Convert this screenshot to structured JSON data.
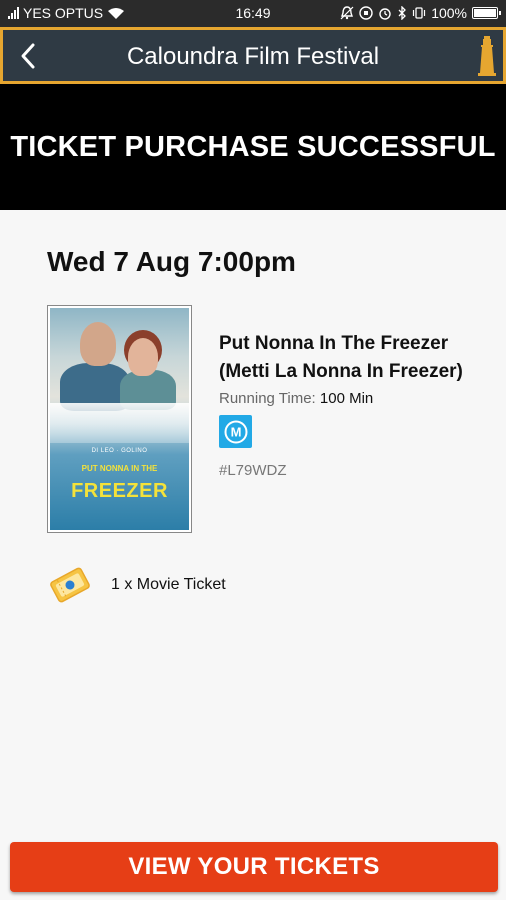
{
  "status_bar": {
    "carrier": "YES OPTUS",
    "time": "16:49",
    "battery_percent": "100%",
    "battery_level": 1.0
  },
  "header": {
    "title": "Caloundra Film Festival",
    "back_icon": "chevron-left-icon",
    "brand_icon": "lighthouse-icon"
  },
  "banner": {
    "text": "TICKET PURCHASE SUCCESSFUL"
  },
  "session": {
    "datetime": "Wed 7 Aug 7:00pm"
  },
  "movie": {
    "poster_credits": "DI LEO · GOLINO",
    "poster_subtitle": "PUT NONNA IN THE",
    "poster_title": "FREEZER",
    "title": "Put Nonna In The Freezer (Metti La Nonna In Freezer)",
    "running_time_label": "Running Time:",
    "running_time_value": "100 Min",
    "rating": "M",
    "booking_ref": "#L79WDZ"
  },
  "ticket": {
    "summary": "1 x Movie Ticket",
    "icon": "ticket-icon"
  },
  "actions": {
    "view_tickets": "VIEW YOUR TICKETS"
  },
  "colors": {
    "accent": "#e6a630",
    "header_bg": "#2f3a44",
    "primary_button": "#e63e16",
    "rating_badge": "#22a9e6"
  }
}
